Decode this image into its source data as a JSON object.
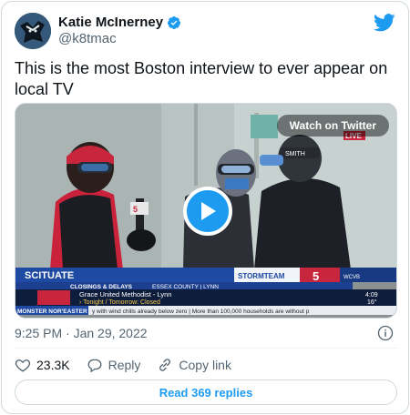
{
  "author": {
    "display_name": "Katie McInerney",
    "handle": "@k8tmac",
    "verified": true
  },
  "tweet": {
    "text": "This is the most Boston interview to ever appear on local TV",
    "timestamp": "9:25 PM · Jan 29, 2022"
  },
  "media": {
    "watch_label": "Watch on Twitter",
    "screen": {
      "location": "SCITUATE",
      "stormteam": "STORMTEAM",
      "channel": "5",
      "live": "LIVE",
      "closings": "CLOSINGS & DELAYS",
      "county": "ESSEX COUNTY | LYNN",
      "school": "Grace United Methodist - Lynn",
      "status": "› Tonight / Tomorrow: Closed",
      "time": "4:09",
      "temp": "16°",
      "ticker_tag": "MONSTER NOR'EASTER",
      "ticker": "y with wind chills already below zero | More than 100,000 households are without p",
      "mic_flag": "5",
      "hat_text": "SMITH",
      "call_sign": "WCVB"
    }
  },
  "actions": {
    "likes": "23.3K",
    "reply_label": "Reply",
    "copy_label": "Copy link"
  },
  "read_replies_label": "Read 369 replies",
  "colors": {
    "accent": "#1d9bf0",
    "like": "#536471",
    "text": "#0f1419",
    "secondary": "#536471"
  },
  "icons": [
    "verified-badge-icon",
    "twitter-bird-icon",
    "play-icon",
    "info-icon",
    "heart-icon",
    "reply-icon",
    "link-icon"
  ]
}
